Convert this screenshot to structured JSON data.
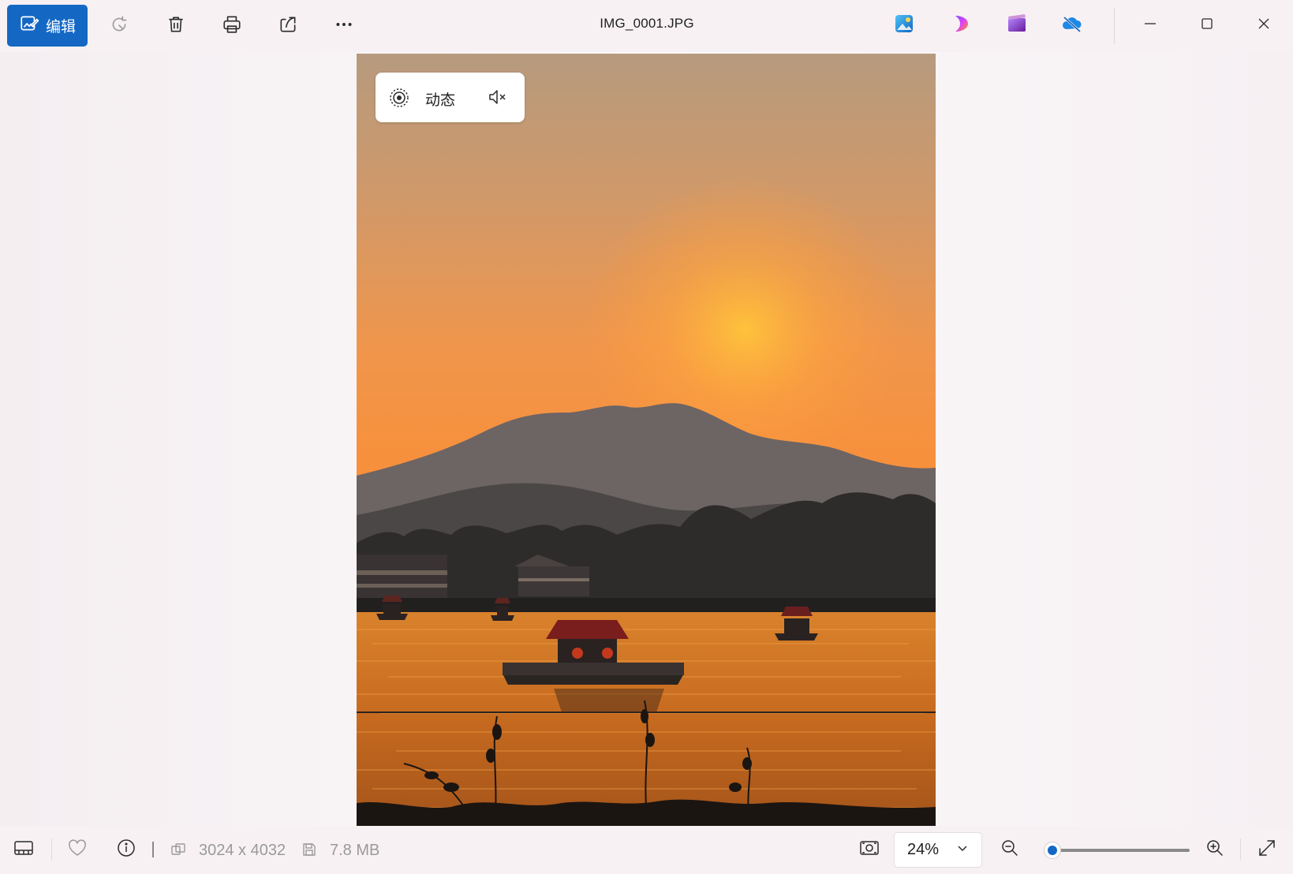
{
  "toolbar": {
    "edit_label": "编辑",
    "file_name": "IMG_0001.JPG",
    "icons": [
      "edit-photo-icon",
      "rotate-icon",
      "delete-icon",
      "print-icon",
      "share-icon",
      "more-icon"
    ],
    "app_icons": [
      "photo-editor-app-icon",
      "clipchamp-app-icon",
      "video-editor-app-icon",
      "onedrive-icon"
    ],
    "window_controls": [
      "minimize-icon",
      "maximize-icon",
      "close-icon"
    ],
    "accent_color": "#1468c4"
  },
  "photo_overlay": {
    "live_label": "动态",
    "live_icon": "live-photo-icon",
    "mute_icon": "volume-mute-icon"
  },
  "statusbar": {
    "icons": [
      "filmstrip-icon",
      "favorite-icon",
      "info-icon",
      "fit-screen-icon",
      "zoom-out-icon",
      "zoom-in-icon",
      "fullscreen-icon"
    ],
    "dimensions": "3024 x 4032",
    "file_size": "7.8 MB",
    "zoom_value": "24%",
    "zoom_slider_level": 0.02
  }
}
